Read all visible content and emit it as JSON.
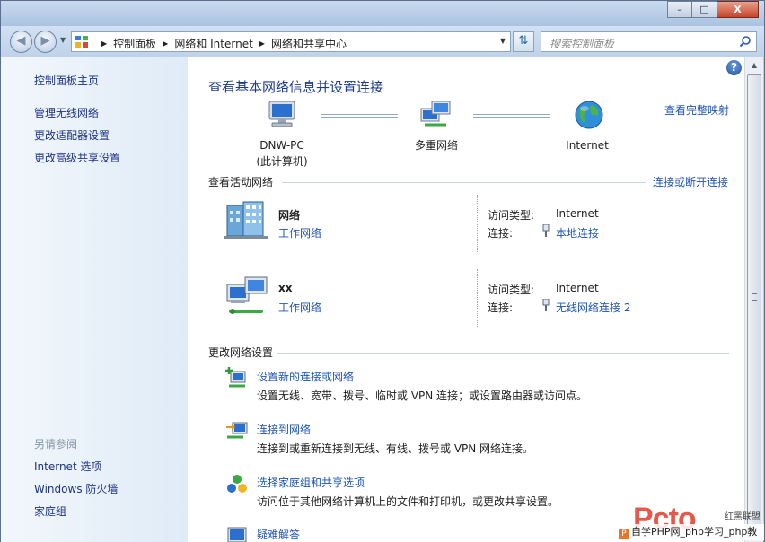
{
  "window": {
    "caption": {
      "minimize": "–",
      "maximize": "□",
      "close": "X"
    }
  },
  "navbar": {
    "breadcrumb": [
      "控制面板",
      "网络和 Internet",
      "网络和共享中心"
    ],
    "search_placeholder": "搜索控制面板"
  },
  "sidebar": {
    "items": [
      "控制面板主页",
      "管理无线网络",
      "更改适配器设置",
      "更改高级共享设置"
    ],
    "see_also_title": "另请参阅",
    "see_also": [
      "Internet 选项",
      "Windows 防火墙",
      "家庭组"
    ]
  },
  "main": {
    "title": "查看基本网络信息并设置连接",
    "view_full_map": "查看完整映射",
    "map": {
      "computer_name": "DNW-PC",
      "computer_sub": "(此计算机)",
      "middle": "多重网络",
      "internet": "Internet"
    },
    "active_title": "查看活动网络",
    "connect_disconnect": "连接或断开连接",
    "networks": [
      {
        "name": "网络",
        "type": "工作网络",
        "access_label": "访问类型:",
        "access": "Internet",
        "conn_label": "连接:",
        "conn": "本地连接"
      },
      {
        "name": "xx",
        "type": "工作网络",
        "access_label": "访问类型:",
        "access": "Internet",
        "conn_label": "连接:",
        "conn": "无线网络连接 2"
      }
    ],
    "change_title": "更改网络设置",
    "tasks": [
      {
        "title": "设置新的连接或网络",
        "desc": "设置无线、宽带、拨号、临时或 VPN 连接；或设置路由器或访问点。"
      },
      {
        "title": "连接到网络",
        "desc": "连接到或重新连接到无线、有线、拨号或 VPN 网络连接。"
      },
      {
        "title": "选择家庭组和共享选项",
        "desc": "访问位于其他网络计算机上的文件和打印机，或更改共享设置。"
      },
      {
        "title": "疑难解答",
        "desc": ""
      }
    ]
  },
  "watermark": {
    "logo": "Pcto",
    "brand": "红黑联盟",
    "text": "自学PHP网_php学习_php教"
  }
}
